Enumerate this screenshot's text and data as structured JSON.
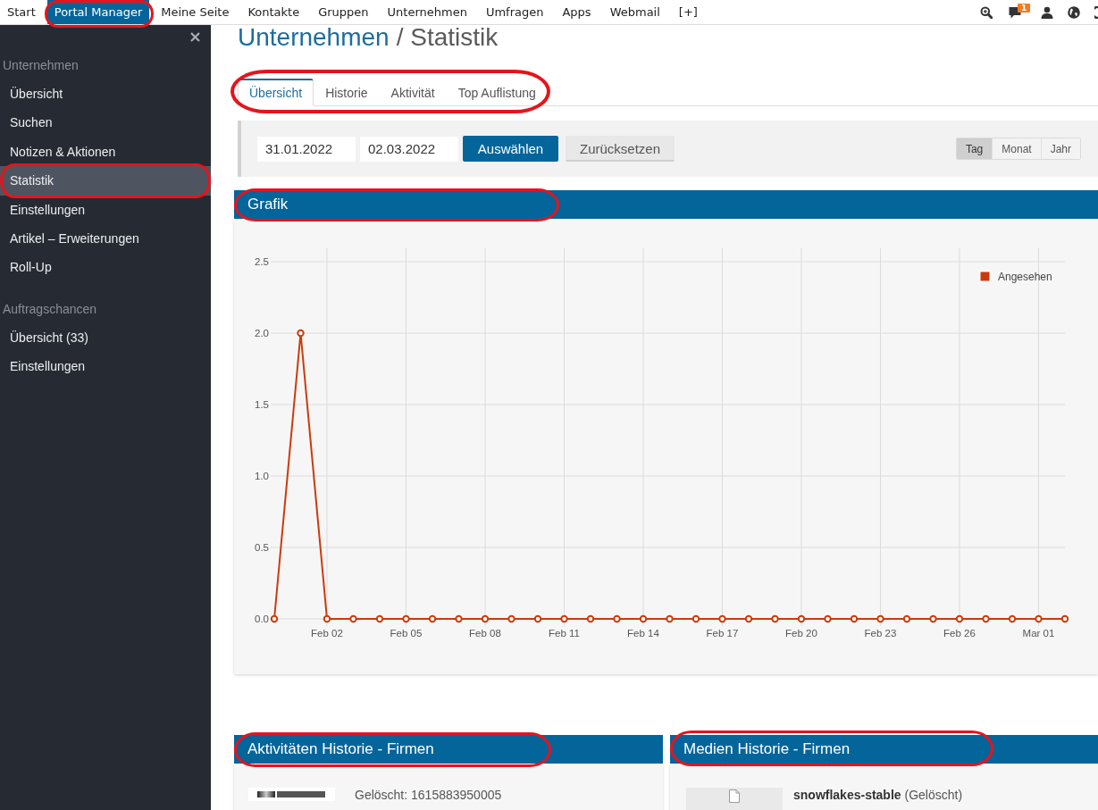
{
  "topnav": {
    "items": [
      {
        "label": "Start",
        "selected": false,
        "highlighted": false
      },
      {
        "label": "Portal Manager",
        "selected": true,
        "highlighted": true
      },
      {
        "label": "Meine Seite",
        "selected": false,
        "highlighted": false
      },
      {
        "label": "Kontakte",
        "selected": false,
        "highlighted": false
      },
      {
        "label": "Gruppen",
        "selected": false,
        "highlighted": false
      },
      {
        "label": "Unternehmen",
        "selected": false,
        "highlighted": false
      },
      {
        "label": "Umfragen",
        "selected": false,
        "highlighted": false
      },
      {
        "label": "Apps",
        "selected": false,
        "highlighted": false
      },
      {
        "label": "Webmail",
        "selected": false,
        "highlighted": false
      },
      {
        "label": "[+]",
        "selected": false,
        "highlighted": false
      }
    ],
    "notification_count": "1"
  },
  "sidebar": {
    "sections": [
      {
        "title": "Unternehmen",
        "items": [
          {
            "label": "Übersicht",
            "selected": false,
            "highlighted": false
          },
          {
            "label": "Suchen",
            "selected": false,
            "highlighted": false
          },
          {
            "label": "Notizen & Aktionen",
            "selected": false,
            "highlighted": false
          },
          {
            "label": "Statistik",
            "selected": true,
            "highlighted": true
          },
          {
            "label": "Einstellungen",
            "selected": false,
            "highlighted": false
          },
          {
            "label": "Artikel – Erweiterungen",
            "selected": false,
            "highlighted": false
          },
          {
            "label": "Roll-Up",
            "selected": false,
            "highlighted": false
          }
        ]
      },
      {
        "title": "Auftragschancen",
        "items": [
          {
            "label": "Übersicht (33)",
            "selected": false,
            "highlighted": false
          },
          {
            "label": "Einstellungen",
            "selected": false,
            "highlighted": false
          }
        ]
      }
    ]
  },
  "page_title": {
    "link": "Unternehmen",
    "current": "/ Statistik"
  },
  "tabs": {
    "highlighted": true,
    "items": [
      {
        "label": "Übersicht",
        "selected": true
      },
      {
        "label": "Historie",
        "selected": false
      },
      {
        "label": "Aktivität",
        "selected": false
      },
      {
        "label": "Top Auflistung",
        "selected": false
      }
    ]
  },
  "filter": {
    "date_from": "31.01.2022",
    "date_to": "02.03.2022",
    "apply_button": "Auswählen",
    "reset_button": "Zurücksetzen",
    "granularity": [
      {
        "label": "Tag",
        "selected": true
      },
      {
        "label": "Monat",
        "selected": false
      },
      {
        "label": "Jahr",
        "selected": false
      }
    ]
  },
  "chart_panel": {
    "title": "Grafik",
    "highlighted": true,
    "chart_data": {
      "type": "line",
      "grid": true,
      "categories": [
        null,
        null,
        "Feb 02",
        null,
        null,
        "Feb 05",
        null,
        null,
        "Feb 08",
        null,
        null,
        "Feb 11",
        null,
        null,
        "Feb 14",
        null,
        null,
        "Feb 17",
        null,
        null,
        "Feb 20",
        null,
        null,
        "Feb 23",
        null,
        null,
        "Feb 26",
        null,
        null,
        "Mar 01",
        null
      ],
      "series": [
        {
          "name": "Angesehen",
          "color": "#cc3a0c",
          "marker": "circle",
          "values": [
            0,
            2,
            0,
            0,
            0,
            0,
            0,
            0,
            0,
            0,
            0,
            0,
            0,
            0,
            0,
            0,
            0,
            0,
            0,
            0,
            0,
            0,
            0,
            0,
            0,
            0,
            0,
            0,
            0,
            0,
            0
          ]
        }
      ],
      "ylim": [
        0,
        2.5
      ],
      "yticks": [
        {
          "value": 0,
          "label": "0.0"
        },
        {
          "value": 0.5,
          "label": "0.5"
        },
        {
          "value": 1,
          "label": "1.0"
        },
        {
          "value": 1.5,
          "label": "1.5"
        },
        {
          "value": 2,
          "label": "2.0"
        },
        {
          "value": 2.5,
          "label": "2.5"
        }
      ]
    }
  },
  "history_panels": [
    {
      "kind": "activity",
      "title": "Aktivitäten Historie - Firmen",
      "highlighted": true,
      "entries": [
        {
          "text": "Gelöscht: 1615883950005"
        }
      ]
    },
    {
      "kind": "media",
      "title": "Medien Historie - Firmen",
      "highlighted": true,
      "entries": [
        {
          "text": "**snowflakes-stable** (Gelöscht)"
        }
      ]
    }
  ]
}
